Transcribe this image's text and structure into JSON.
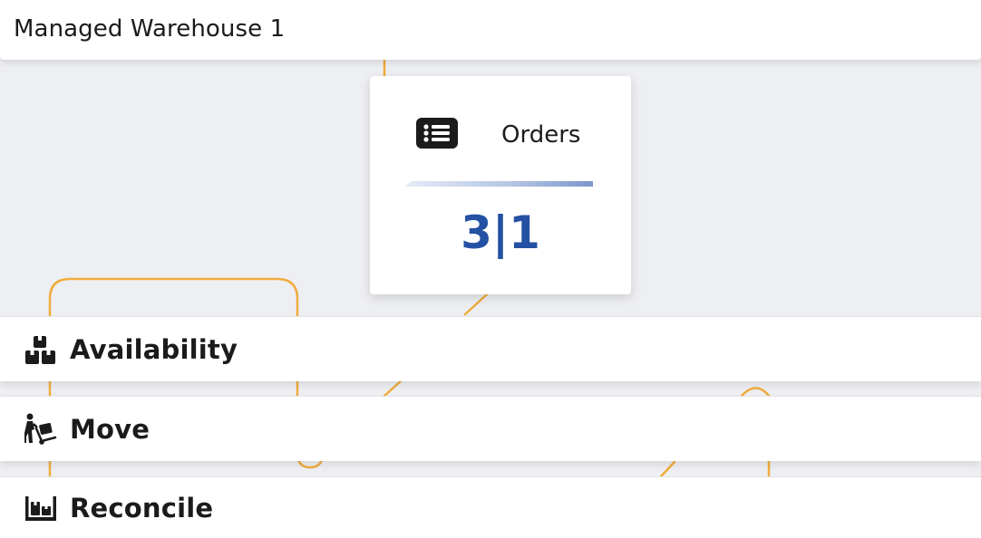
{
  "header": {
    "title": "Managed Warehouse 1"
  },
  "orders_card": {
    "icon": "list-icon",
    "label": "Orders",
    "count": "3|1"
  },
  "actions": [
    {
      "label": "Availability",
      "icon": "boxes-icon"
    },
    {
      "label": "Move",
      "icon": "hand-truck-icon"
    },
    {
      "label": "Reconcile",
      "icon": "pallet-icon"
    }
  ],
  "colors": {
    "accent": "#2451a3",
    "flow_line": "#f0a833",
    "background": "#eeeff3"
  }
}
